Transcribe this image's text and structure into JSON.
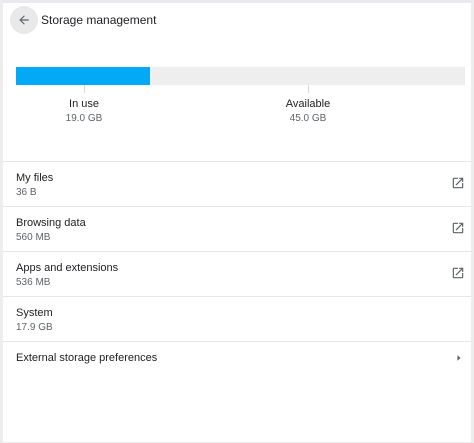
{
  "header": {
    "back_icon": "arrow-left-icon",
    "title": "Storage management"
  },
  "storage": {
    "used_fraction": 0.298,
    "fill_color": "#03a9f4",
    "track_color": "#eeeeee",
    "in_use": {
      "label": "In use",
      "value": "19.0 GB"
    },
    "available": {
      "label": "Available",
      "value": "45.0 GB"
    }
  },
  "items": [
    {
      "title": "My files",
      "subtitle": "36 B",
      "icon": "open-in-new-icon"
    },
    {
      "title": "Browsing data",
      "subtitle": "560 MB",
      "icon": "open-in-new-icon"
    },
    {
      "title": "Apps and extensions",
      "subtitle": "536 MB",
      "icon": "open-in-new-icon"
    },
    {
      "title": "System",
      "subtitle": "17.9 GB"
    }
  ],
  "external": {
    "title": "External storage preferences",
    "icon": "chevron-right-icon"
  }
}
